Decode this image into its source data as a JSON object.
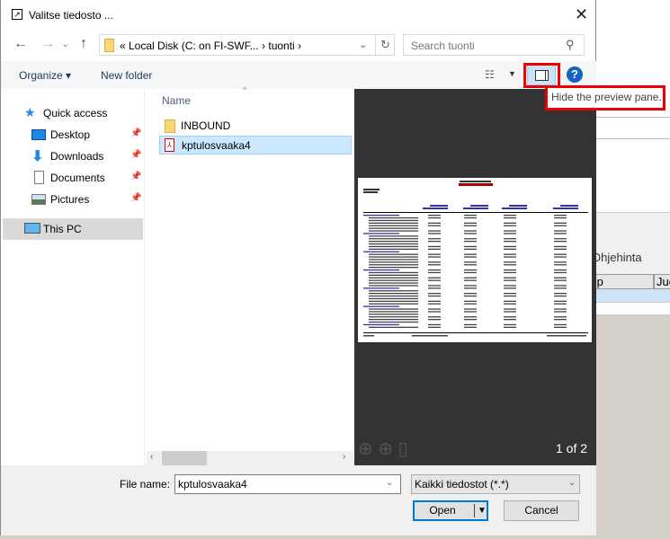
{
  "dialog": {
    "title": "Valitse tiedosto ...",
    "close_icon": "close-icon",
    "address": {
      "path": "«  Local Disk (C: on FI-SWF...  ›  tuonti  ›",
      "search_placeholder": "Search tuonti"
    },
    "toolbar": {
      "organize_label": "Organize ▾",
      "new_folder_label": "New folder",
      "preview_pane_highlighted": true,
      "tooltip": "Hide the preview pane."
    },
    "nav": {
      "items": [
        {
          "label": "Quick access",
          "icon": "star-icon"
        },
        {
          "label": "Desktop",
          "icon": "desktop-icon",
          "pinned": true
        },
        {
          "label": "Downloads",
          "icon": "download-icon",
          "pinned": true
        },
        {
          "label": "Documents",
          "icon": "documents-icon",
          "pinned": true
        },
        {
          "label": "Pictures",
          "icon": "pictures-icon",
          "pinned": true
        },
        {
          "label": "This PC",
          "icon": "computer-icon",
          "selected": true
        }
      ]
    },
    "filelist": {
      "column_name": "Name",
      "files": [
        {
          "name": "INBOUND",
          "icon": "folder-icon"
        },
        {
          "name": "kptulosvaaka4",
          "icon": "pdf-icon",
          "selected": true
        }
      ]
    },
    "preview": {
      "page_indicator": "1 of 2"
    },
    "footer": {
      "file_name_label": "File name:",
      "file_name_value": "kptulosvaaka4",
      "file_type": "Kaikki tiedostot (*.*)",
      "open_label": "Open",
      "cancel_label": "Cancel"
    }
  },
  "background_app": {
    "field_label": "Ohjehinta",
    "columns": [
      "Kp",
      "Juo"
    ]
  },
  "colors": {
    "highlight": "#e00000",
    "selection": "#cce4f7",
    "preview_bg": "#333333",
    "accent": "#0078d7"
  }
}
